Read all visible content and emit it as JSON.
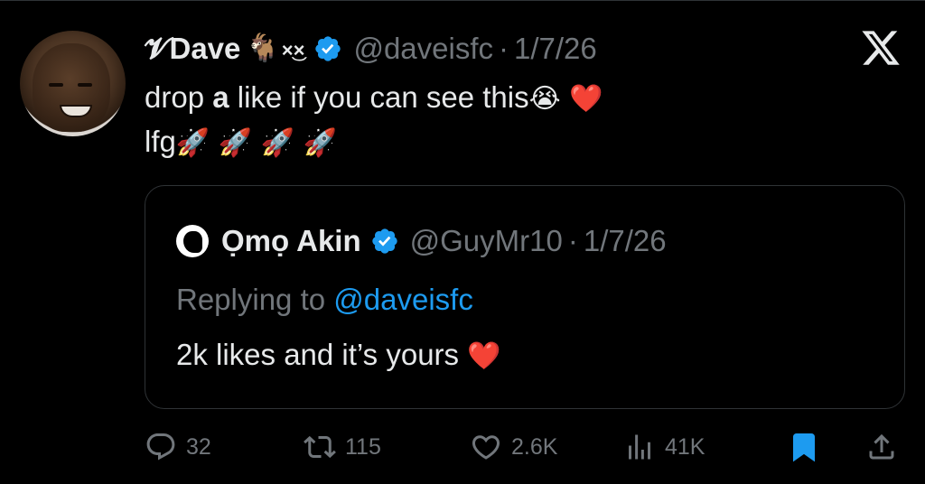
{
  "tweet": {
    "display_name": "𝓥Dave",
    "name_emoji": "🐐",
    "name_suffix": "×͜×",
    "handle": "@daveisfc",
    "separator": "·",
    "date": "1/7/26",
    "line1_before": "drop ",
    "line1_bold": "a",
    "line1_after": " like if you can see this",
    "line1_emojis": "😭 ❤️",
    "line2_text": "lfg",
    "line2_emojis": "🚀 🚀 🚀 🚀"
  },
  "quote": {
    "display_name": "Ọmọ Akin",
    "handle": "@GuyMr10",
    "separator": "·",
    "date": "1/7/26",
    "replying_label": "Replying to",
    "replying_handle": "@daveisfc",
    "text": "2k likes and it’s yours",
    "text_emoji": "❤️"
  },
  "actions": {
    "replies": "32",
    "reposts": "115",
    "likes": "2.6K",
    "views": "41K"
  },
  "icons": {
    "verified": "verified-badge-icon",
    "logo": "x-logo-icon",
    "reply": "reply-icon",
    "repost": "repost-icon",
    "like": "heart-icon",
    "views": "views-icon",
    "bookmark": "bookmark-icon",
    "share": "share-icon"
  },
  "colors": {
    "background": "#000000",
    "text": "#e7e9ea",
    "secondary": "#71767b",
    "accent": "#1d9bf0",
    "bookmark_fill": "#1d9bf0",
    "border": "#2f3336"
  }
}
